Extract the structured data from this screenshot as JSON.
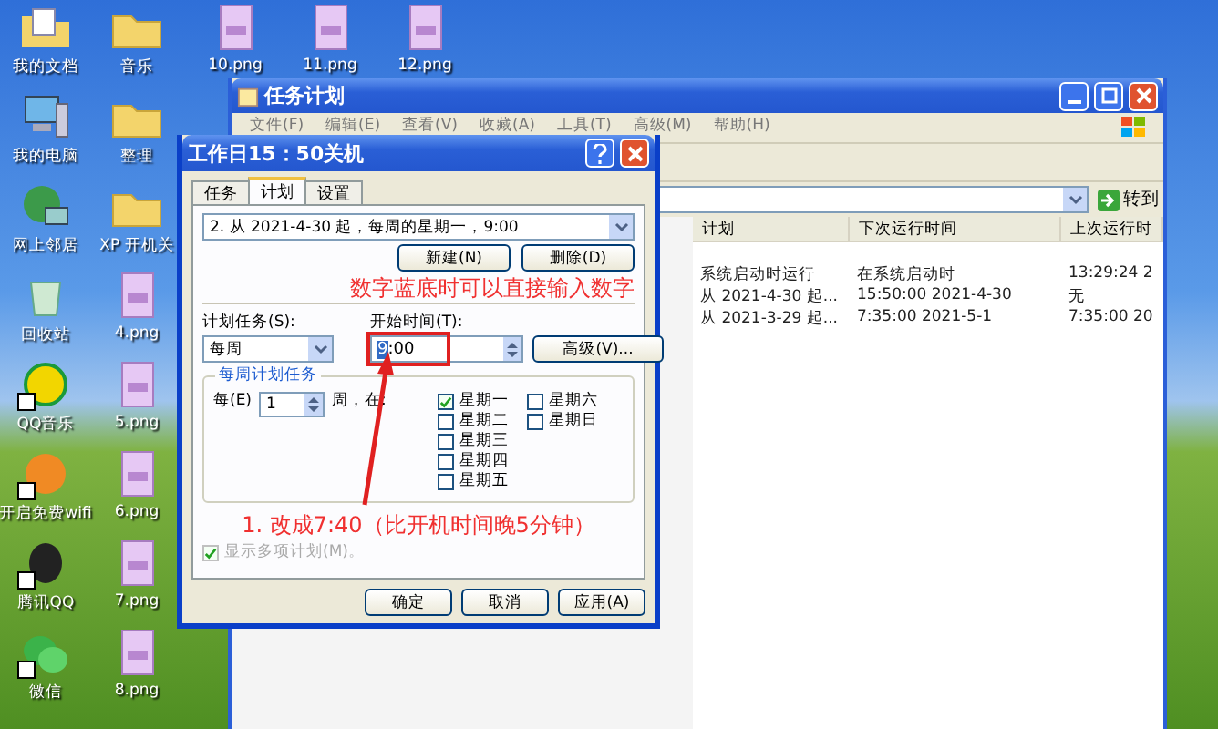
{
  "desktop_icons": [
    {
      "label": "我的文档",
      "kind": "documents"
    },
    {
      "label": "我的电脑",
      "kind": "computer"
    },
    {
      "label": "网上邻居",
      "kind": "network"
    },
    {
      "label": "回收站",
      "kind": "recycle"
    },
    {
      "label": "QQ音乐",
      "kind": "music",
      "shortcut": true
    },
    {
      "label": "开启免费wifi",
      "kind": "wifi",
      "shortcut": true
    },
    {
      "label": "腾讯QQ",
      "kind": "qq",
      "shortcut": true
    },
    {
      "label": "微信",
      "kind": "wechat",
      "shortcut": true
    },
    {
      "label": "音乐",
      "kind": "folder"
    },
    {
      "label": "整理",
      "kind": "folder"
    },
    {
      "label": "XP 开机关",
      "kind": "folder"
    },
    {
      "label": "4.png",
      "kind": "image"
    },
    {
      "label": "5.png",
      "kind": "image"
    },
    {
      "label": "6.png",
      "kind": "image"
    },
    {
      "label": "7.png",
      "kind": "image"
    },
    {
      "label": "8.png",
      "kind": "image"
    }
  ],
  "top_icons": [
    {
      "label": "10.png"
    },
    {
      "label": "11.png"
    },
    {
      "label": "12.png"
    }
  ],
  "scheduler_window": {
    "title": "任务计划",
    "menu": [
      "文件(F)",
      "编辑(E)",
      "查看(V)",
      "收藏(A)",
      "工具(T)",
      "高级(M)",
      "帮助(H)"
    ],
    "go_button": "转到",
    "columns": [
      "计划",
      "下次运行时间",
      "上次运行时"
    ],
    "rows": [
      {
        "cells": [
          "系统启动时运行",
          "在系统启动时",
          "13:29:24 2"
        ]
      },
      {
        "cells": [
          "从 2021-4-30 起...",
          "15:50:00 2021-4-30",
          "无"
        ]
      },
      {
        "cells": [
          "从 2021-3-29 起...",
          "7:35:00 2021-5-1",
          "7:35:00 20"
        ]
      }
    ]
  },
  "dialog": {
    "title": "工作日15：50关机",
    "tabs": [
      {
        "label": "任务",
        "selected": false
      },
      {
        "label": "计划",
        "selected": true
      },
      {
        "label": "设置",
        "selected": false
      }
    ],
    "schedule_select": "2. 从 2021-4-30 起，每周的星期一，9:00",
    "new_button": "新建(N)",
    "delete_button": "删除(D)",
    "schedule_label": "计划任务(S):",
    "schedule_value": "每周",
    "start_label": "开始时间(T):",
    "start_hour": "9",
    "start_rest": ":00",
    "advanced_button": "高级(V)...",
    "group_title": "每周计划任务",
    "every_label": "每(E)",
    "every_value": "1",
    "weeks_label": "周，在:",
    "days": [
      {
        "label": "星期一",
        "checked": true
      },
      {
        "label": "星期二",
        "checked": false
      },
      {
        "label": "星期三",
        "checked": false
      },
      {
        "label": "星期四",
        "checked": false
      },
      {
        "label": "星期五",
        "checked": false
      },
      {
        "label": "星期六",
        "checked": false
      },
      {
        "label": "星期日",
        "checked": false
      }
    ],
    "multi": {
      "label": "显示多项计划(M)。",
      "checked": true,
      "disabled": true
    },
    "buttons": [
      "确定",
      "取消",
      "应用(A)"
    ]
  },
  "annotations": {
    "hint": "数字蓝底时可以直接输入数字",
    "step": "1. 改成7:40（比开机时间晚5分钟）"
  }
}
